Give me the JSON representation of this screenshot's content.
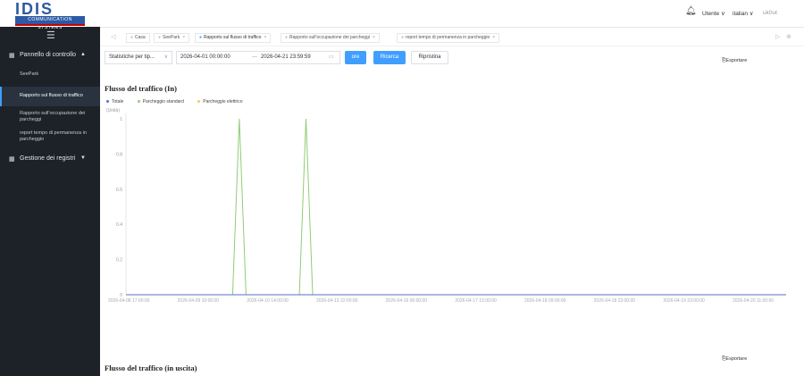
{
  "logo": {
    "text": "IDIS",
    "subtitle": "COMMUNICATION SYSTEMS"
  },
  "sidebar": {
    "group1": {
      "icon": "grid-icon",
      "label": "Pannello di controllo",
      "chevron": "▲"
    },
    "items": [
      {
        "label": "SeePark"
      },
      {
        "label": "Rapporto sul flusso di traffico"
      },
      {
        "label": "Rapporto sull'occupazione dei parcheggi"
      },
      {
        "label": "report tempo di permanenza in parcheggio"
      }
    ],
    "group2": {
      "icon": "grid-icon",
      "label": "Gestione dei registri",
      "chevron": "▼"
    }
  },
  "topbar": {
    "user": "Utente ∨",
    "language": "italian ∨",
    "extra": "uk0ut"
  },
  "tabs": [
    {
      "label": "Casa",
      "closable": false,
      "active": false
    },
    {
      "label": "SeePark",
      "closable": true,
      "active": false
    },
    {
      "label": "Rapporto sul flusso di traffico",
      "closable": true,
      "active": true
    },
    {
      "label": "Rapporto sull'occupazione dei parcheggi",
      "closable": true,
      "active": false
    },
    {
      "label": "report tempo di permanenza in parcheggio",
      "closable": true,
      "active": false
    }
  ],
  "filters": {
    "stat_type": "Statistiche per tip...",
    "start": "2026-04-01 00:00:00",
    "sep": "—",
    "end": "2026-04-21 23:59:59",
    "ore_label": "ore",
    "search_label": "Ricerca",
    "reset_label": "Ripristina"
  },
  "export_label": "Esportare",
  "section_in_title": "Flusso del traffico (In)",
  "section_out_title": "Flusso del traffico (in uscita)",
  "colors": {
    "totale": "#5470c6",
    "standard": "#91cc75",
    "elettrico": "#fac858",
    "accent": "#409eff"
  },
  "chart_data": {
    "type": "line",
    "title": "Flusso del traffico (In)",
    "ylabel": "(Unità)",
    "ylim": [
      0,
      1
    ],
    "yticks": [
      0,
      0.2,
      0.4,
      0.6,
      0.8,
      1
    ],
    "grid": false,
    "legend_position": "top-left",
    "x_tick_labels": [
      "2026-04-08 17:00:00",
      "2026-04-09 10:00:00",
      "2026-04-10 14:00:00",
      "2026-04-13 22:00:00",
      "2026-04-16 06:00:00",
      "2026-04-17 15:00:00",
      "2026-04-18 09:00:00",
      "2026-04-18 23:00:00",
      "2026-04-19 23:00:00",
      "2026-04-20 11:00:00"
    ],
    "n_points": 100,
    "series": [
      {
        "name": "Totale",
        "color": "#5470c6",
        "spikes": []
      },
      {
        "name": "Parcheggio standard",
        "color": "#91cc75",
        "spikes": [
          [
            17,
            1
          ],
          [
            27,
            1
          ]
        ]
      },
      {
        "name": "Parcheggio elettrico",
        "color": "#fac858",
        "spikes": []
      }
    ]
  }
}
